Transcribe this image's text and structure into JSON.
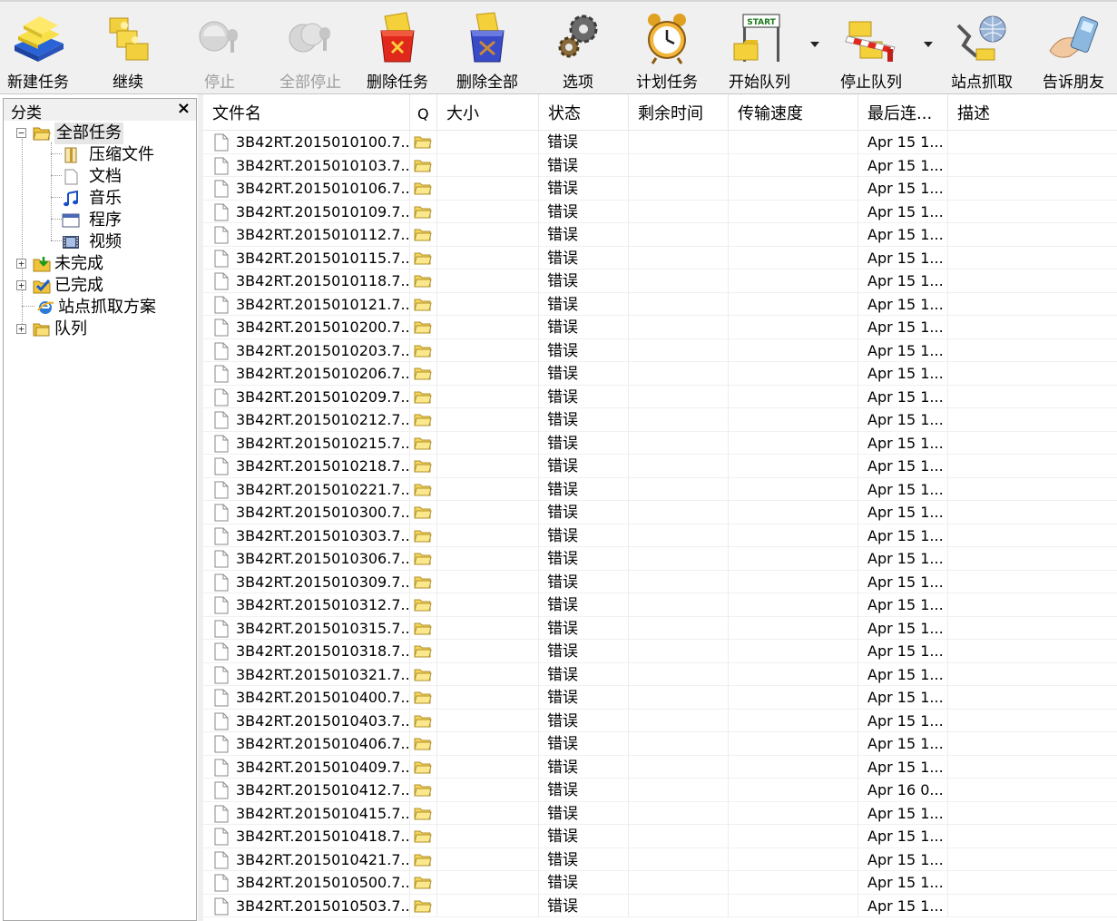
{
  "toolbar": {
    "buttons": [
      {
        "label": "新建任务",
        "icon": "new-task-icon",
        "enabled": true
      },
      {
        "label": "继续",
        "icon": "resume-icon",
        "enabled": true
      },
      {
        "label": "停止",
        "icon": "stop-icon",
        "enabled": false
      },
      {
        "label": "全部停止",
        "icon": "stop-all-icon",
        "enabled": false
      },
      {
        "label": "删除任务",
        "icon": "delete-task-icon",
        "enabled": true
      },
      {
        "label": "删除全部",
        "icon": "delete-all-icon",
        "enabled": true
      },
      {
        "label": "选项",
        "icon": "gear-icon",
        "enabled": true
      },
      {
        "label": "计划任务",
        "icon": "alarm-clock-icon",
        "enabled": true
      },
      {
        "label": "开始队列",
        "icon": "start-queue-icon",
        "enabled": true
      },
      {
        "label": "停止队列",
        "icon": "stop-queue-icon",
        "enabled": true
      },
      {
        "label": "站点抓取",
        "icon": "site-grabber-icon",
        "enabled": true
      },
      {
        "label": "告诉朋友",
        "icon": "tell-friend-icon",
        "enabled": true
      }
    ],
    "start_badge": "START"
  },
  "sidebar": {
    "title": "分类",
    "close_glyph": "×",
    "root": {
      "label": "全部任务",
      "expander": "−"
    },
    "children": [
      {
        "label": "压缩文件",
        "icon": "archive-icon"
      },
      {
        "label": "文档",
        "icon": "document-icon"
      },
      {
        "label": "音乐",
        "icon": "music-note-icon"
      },
      {
        "label": "程序",
        "icon": "program-window-icon"
      },
      {
        "label": "视频",
        "icon": "film-icon"
      }
    ],
    "top_nodes": [
      {
        "label": "未完成",
        "icon": "download-folder-icon",
        "expander": "+"
      },
      {
        "label": "已完成",
        "icon": "checkmark-folder-icon",
        "expander": "+"
      },
      {
        "label": "站点抓取方案",
        "icon": "ie-globe-icon",
        "expander": ""
      },
      {
        "label": "队列",
        "icon": "queue-folder-icon",
        "expander": "+"
      }
    ]
  },
  "table": {
    "columns": [
      "文件名",
      "Q",
      "大小",
      "状态",
      "剩余时间",
      "传输速度",
      "最后连...",
      "描述"
    ],
    "rows": [
      {
        "name": "3B42RT.2015010100.7...",
        "status": "错误",
        "last": "Apr 15 1..."
      },
      {
        "name": "3B42RT.2015010103.7...",
        "status": "错误",
        "last": "Apr 15 1..."
      },
      {
        "name": "3B42RT.2015010106.7...",
        "status": "错误",
        "last": "Apr 15 1..."
      },
      {
        "name": "3B42RT.2015010109.7...",
        "status": "错误",
        "last": "Apr 15 1..."
      },
      {
        "name": "3B42RT.2015010112.7...",
        "status": "错误",
        "last": "Apr 15 1..."
      },
      {
        "name": "3B42RT.2015010115.7...",
        "status": "错误",
        "last": "Apr 15 1..."
      },
      {
        "name": "3B42RT.2015010118.7...",
        "status": "错误",
        "last": "Apr 15 1..."
      },
      {
        "name": "3B42RT.2015010121.7...",
        "status": "错误",
        "last": "Apr 15 1..."
      },
      {
        "name": "3B42RT.2015010200.7...",
        "status": "错误",
        "last": "Apr 15 1..."
      },
      {
        "name": "3B42RT.2015010203.7...",
        "status": "错误",
        "last": "Apr 15 1..."
      },
      {
        "name": "3B42RT.2015010206.7...",
        "status": "错误",
        "last": "Apr 15 1..."
      },
      {
        "name": "3B42RT.2015010209.7...",
        "status": "错误",
        "last": "Apr 15 1..."
      },
      {
        "name": "3B42RT.2015010212.7...",
        "status": "错误",
        "last": "Apr 15 1..."
      },
      {
        "name": "3B42RT.2015010215.7...",
        "status": "错误",
        "last": "Apr 15 1..."
      },
      {
        "name": "3B42RT.2015010218.7...",
        "status": "错误",
        "last": "Apr 15 1..."
      },
      {
        "name": "3B42RT.2015010221.7...",
        "status": "错误",
        "last": "Apr 15 1..."
      },
      {
        "name": "3B42RT.2015010300.7...",
        "status": "错误",
        "last": "Apr 15 1..."
      },
      {
        "name": "3B42RT.2015010303.7...",
        "status": "错误",
        "last": "Apr 15 1..."
      },
      {
        "name": "3B42RT.2015010306.7...",
        "status": "错误",
        "last": "Apr 15 1..."
      },
      {
        "name": "3B42RT.2015010309.7...",
        "status": "错误",
        "last": "Apr 15 1..."
      },
      {
        "name": "3B42RT.2015010312.7...",
        "status": "错误",
        "last": "Apr 15 1..."
      },
      {
        "name": "3B42RT.2015010315.7...",
        "status": "错误",
        "last": "Apr 15 1..."
      },
      {
        "name": "3B42RT.2015010318.7...",
        "status": "错误",
        "last": "Apr 15 1..."
      },
      {
        "name": "3B42RT.2015010321.7...",
        "status": "错误",
        "last": "Apr 15 1..."
      },
      {
        "name": "3B42RT.2015010400.7...",
        "status": "错误",
        "last": "Apr 15 1..."
      },
      {
        "name": "3B42RT.2015010403.7...",
        "status": "错误",
        "last": "Apr 15 1..."
      },
      {
        "name": "3B42RT.2015010406.7...",
        "status": "错误",
        "last": "Apr 15 1..."
      },
      {
        "name": "3B42RT.2015010409.7...",
        "status": "错误",
        "last": "Apr 15 1..."
      },
      {
        "name": "3B42RT.2015010412.7...",
        "status": "错误",
        "last": "Apr 16 0..."
      },
      {
        "name": "3B42RT.2015010415.7...",
        "status": "错误",
        "last": "Apr 15 1..."
      },
      {
        "name": "3B42RT.2015010418.7...",
        "status": "错误",
        "last": "Apr 15 1..."
      },
      {
        "name": "3B42RT.2015010421.7...",
        "status": "错误",
        "last": "Apr 15 1..."
      },
      {
        "name": "3B42RT.2015010500.7...",
        "status": "错误",
        "last": "Apr 15 1..."
      },
      {
        "name": "3B42RT.2015010503.7...",
        "status": "错误",
        "last": "Apr 15 1..."
      }
    ]
  },
  "colors": {
    "toolbar_bg": "#f0f0f0",
    "disabled_text": "#9d9d9d",
    "folder_yellow": "#f5d45a",
    "grid_line": "#ececec"
  }
}
